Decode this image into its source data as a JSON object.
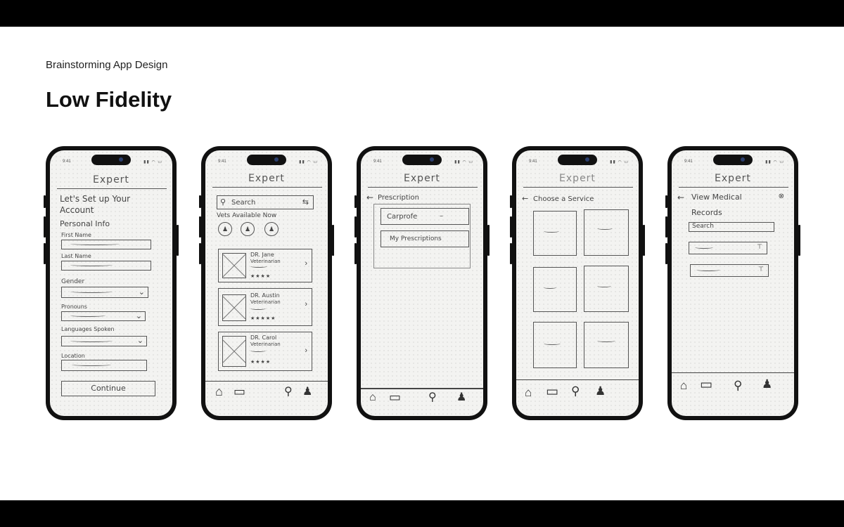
{
  "slide": {
    "subtitle": "Brainstorming App Design",
    "title": "Low Fidelity"
  },
  "status": {
    "time": "9:41",
    "icons": "▮▮ ◠ ▭"
  },
  "phones": [
    {
      "header": "Expert",
      "heading_line1": "Let's Set up Your",
      "heading_line2": "Account",
      "section": "Personal Info",
      "fields": [
        {
          "label": "First Name"
        },
        {
          "label": "Last Name"
        },
        {
          "label": "Gender"
        },
        {
          "label": "Pronouns"
        },
        {
          "label": "Languages Spoken"
        },
        {
          "label": "Location"
        }
      ],
      "button": "Continue"
    },
    {
      "header": "Expert",
      "search_placeholder": "Search",
      "available_label": "Vets Available Now",
      "vets": [
        {
          "name": "DR. Jane",
          "role": "Veterinarian"
        },
        {
          "name": "DR. Austin",
          "role": "Veterinarian"
        },
        {
          "name": "DR. Carol",
          "role": "Veterinarian"
        }
      ]
    },
    {
      "header": "Expert",
      "back_title": "Prescription",
      "dropdown": "Carprofe",
      "link": "My Prescriptions"
    },
    {
      "header": "Expert",
      "back_title": "Choose a Service"
    },
    {
      "header": "Expert",
      "back_title_line1": "View Medical",
      "back_title_line2": "Records",
      "search_placeholder": "Search"
    }
  ],
  "icons": {
    "home": "⌂",
    "calendar": "▭",
    "search": "⚲",
    "profile": "♟",
    "back": "←",
    "chevron": "›",
    "dropdown": "⌄",
    "filter": "⇆"
  }
}
